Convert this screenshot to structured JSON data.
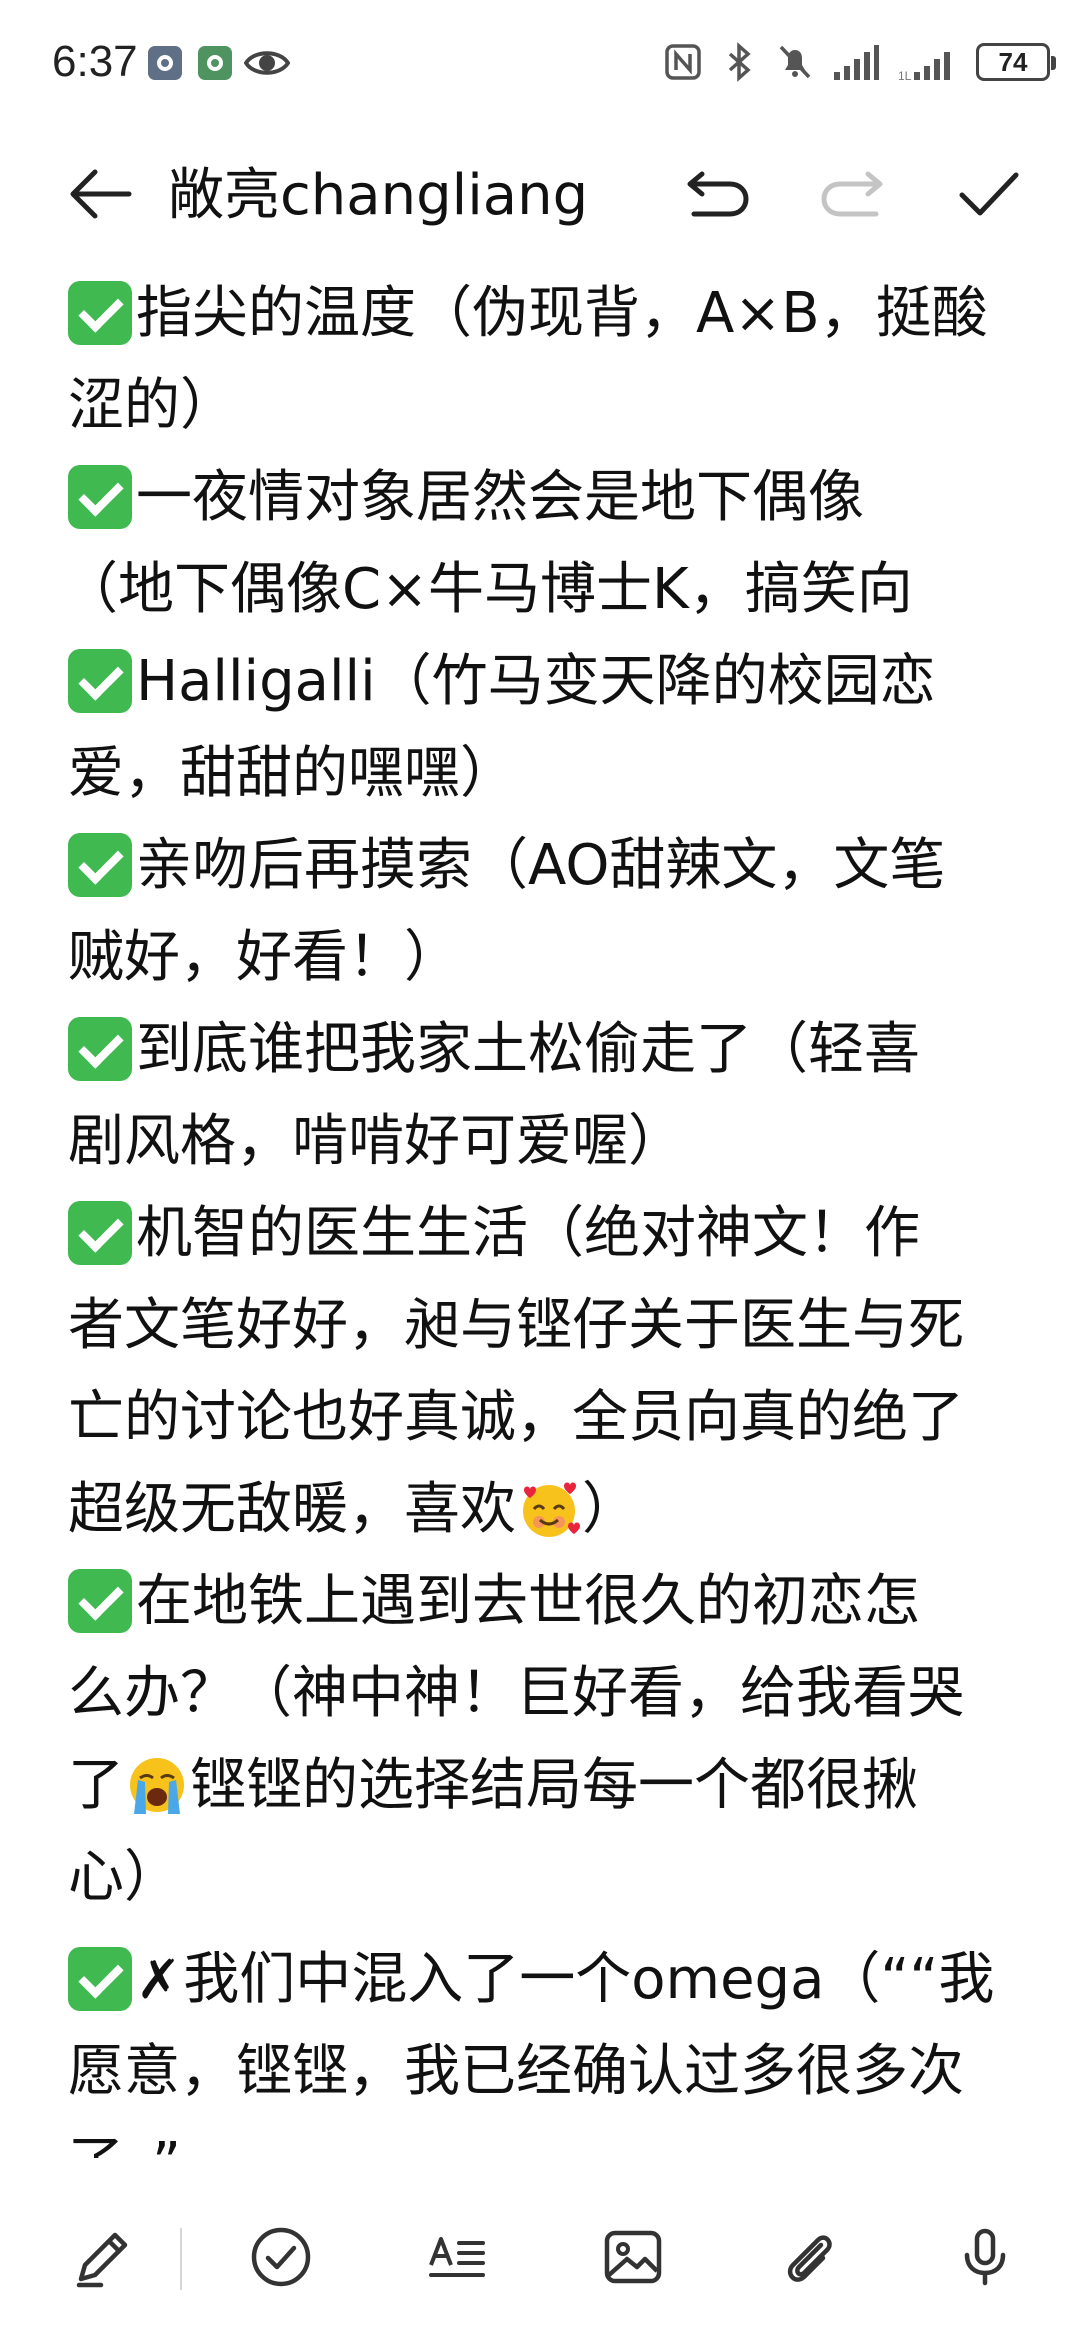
{
  "status_bar": {
    "time": "6:37",
    "battery": "74",
    "icons": [
      "app-icon-1",
      "app-icon-2",
      "eye-icon",
      "nfc-icon",
      "bluetooth-icon",
      "mute-icon",
      "signal-icon",
      "signal-icon-2",
      "battery-icon"
    ]
  },
  "toolbar": {
    "title": "敞亮changliang",
    "icons": [
      "back-arrow-icon",
      "undo-icon",
      "redo-icon",
      "checkmark-icon"
    ]
  },
  "note": {
    "lines": [
      "指尖的温度（伪现背，A×B，挺酸",
      "涩的）",
      "一夜情对象居然会是地下偶像",
      "（地下偶像C×牛马博士K，搞笑向",
      "Halligalli（竹马变天降的校园恋",
      "爱，甜甜的嘿嘿）",
      "亲吻后再摸索（AO甜辣文，文笔",
      "贼好，好看！）",
      "到底谁把我家土松偷走了（轻喜",
      "剧风格，啃啃好可爱喔）",
      "机智的医生生活（绝对神文！作",
      "者文笔好好，昶与铿仔关于医生与死",
      "亡的讨论也好真诚，全员向真的绝了",
      "超级无敌暖，喜欢",
      "）",
      "在地铁上遇到去世很久的初恋怎",
      "么办？（神中神！巨好看，给我看哭",
      "了",
      "铿铿的选择结局每一个都很揪",
      "心）",
      "✗",
      "我们中混入了一个omega（““我",
      "愿意，铿铿，我已经确认过多很多次",
      "了。”"
    ]
  },
  "bottom_bar": {
    "icons": [
      "pen-icon",
      "check-circle-icon",
      "text-format-icon",
      "image-icon",
      "attachment-icon",
      "microphone-icon"
    ]
  },
  "colors": {
    "check_green": "#3fb950",
    "text": "#111111",
    "icon_gray": "#333333"
  }
}
